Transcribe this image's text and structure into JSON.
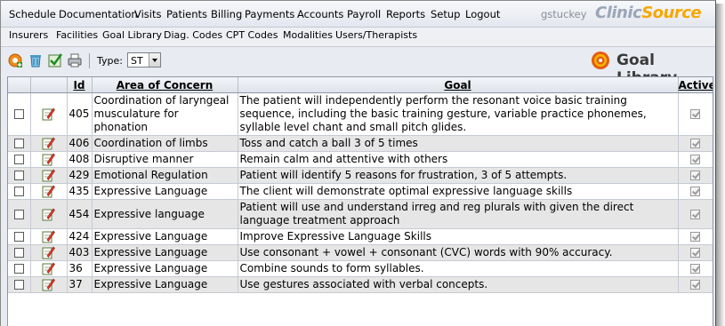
{
  "menu": {
    "items": [
      "Schedule",
      "Documentation",
      "Visits",
      "Patients",
      "Billing",
      "Payments",
      "Accounts",
      "Payroll",
      "Reports",
      "Setup",
      "Logout"
    ],
    "user": "gstuckey",
    "logo_part1": "Clinic",
    "logo_part2": "Source"
  },
  "submenu": {
    "items": [
      "Insurers",
      "Facilities",
      "Goal Library",
      "Diag. Codes",
      "CPT Codes",
      "Modalities",
      "Users/Therapists"
    ]
  },
  "toolbar": {
    "icons": [
      "add-icon",
      "delete-icon",
      "activate-icon",
      "print-icon"
    ],
    "type_label": "Type:",
    "type_value": "ST",
    "title": "Goal Library"
  },
  "table": {
    "headers": {
      "id": "Id",
      "area": "Area of Concern",
      "goal": "Goal",
      "active": "Active"
    },
    "rows": [
      {
        "id": "405",
        "area": "Coordination of laryngeal musculature for phonation",
        "goal": "The patient will independently perform the resonant voice basic training sequence, including the basic training gesture, variable practice phonemes, syllable level chant and small pitch glides.",
        "active": true
      },
      {
        "id": "406",
        "area": "Coordination of limbs",
        "goal": "Toss and catch a ball 3 of 5 times",
        "active": true
      },
      {
        "id": "408",
        "area": "Disruptive manner",
        "goal": "Remain calm and attentive with others",
        "active": true
      },
      {
        "id": "429",
        "area": "Emotional Regulation",
        "goal": "Patient will identify 5 reasons for frustration, 3 of 5 attempts.",
        "active": true
      },
      {
        "id": "435",
        "area": "Expressive Language",
        "goal": "The client will demonstrate optimal expressive language skills",
        "active": true
      },
      {
        "id": "454",
        "area": "Expressive language",
        "goal": "Patient will use and understand irreg and reg plurals with given the direct language treatment approach",
        "active": true
      },
      {
        "id": "424",
        "area": "Expressive Language",
        "goal": "Improve Expressive Language Skills",
        "active": true
      },
      {
        "id": "403",
        "area": "Expressive Language",
        "goal": "Use consonant + vowel + consonant (CVC) words with 90% accuracy.",
        "active": true
      },
      {
        "id": "36",
        "area": "Expressive Language",
        "goal": "Combine sounds to form syllables.",
        "active": true
      },
      {
        "id": "37",
        "area": "Expressive Language",
        "goal": "Use gestures associated with verbal concepts.",
        "active": true
      }
    ]
  }
}
